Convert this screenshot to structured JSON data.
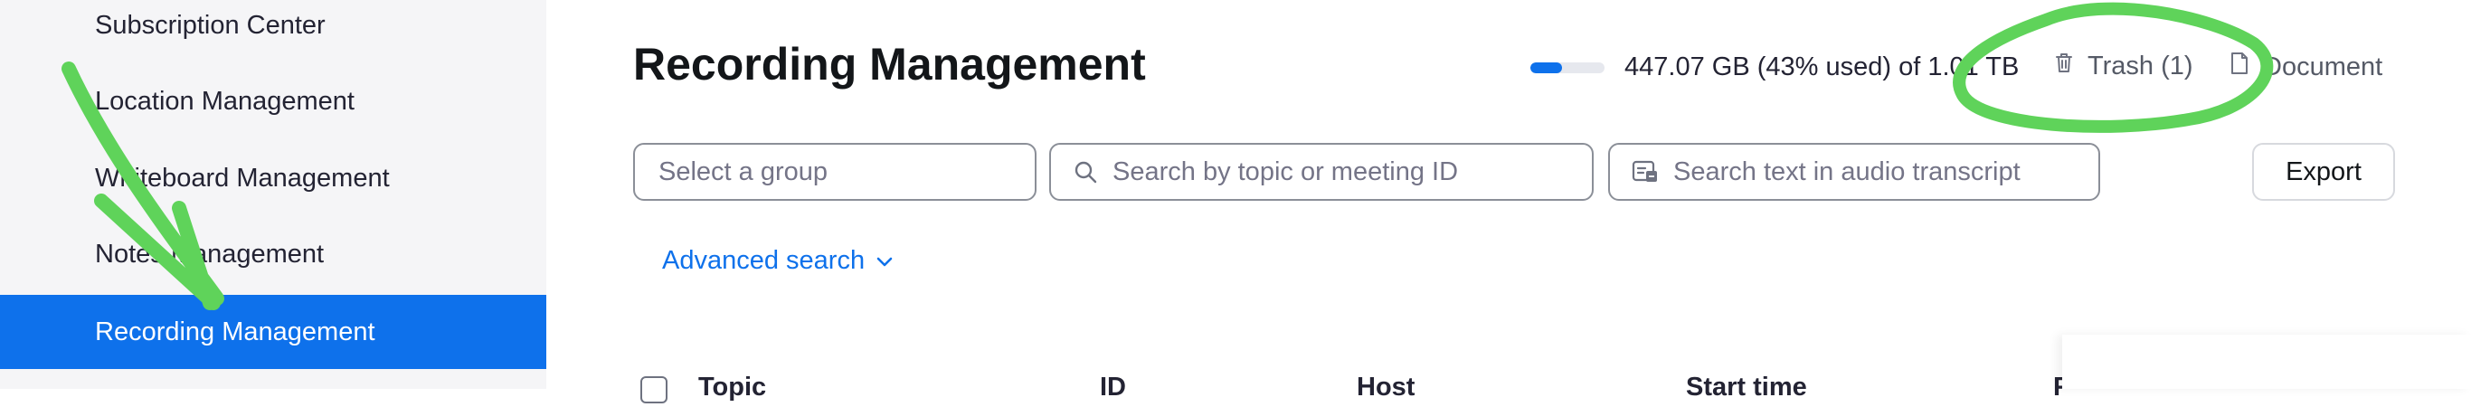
{
  "sidebar": {
    "items": [
      {
        "label": "Subscription Center"
      },
      {
        "label": "Location Management"
      },
      {
        "label": "Whiteboard Management"
      },
      {
        "label": "Notes Management"
      },
      {
        "label": "Recording Management",
        "active": true
      }
    ]
  },
  "header": {
    "title": "Recording Management",
    "storage": {
      "used_fraction": 0.43,
      "text": "447.07 GB (43% used) of 1.01 TB"
    },
    "trash_label": "Trash (1)",
    "document_label": "Document"
  },
  "filters": {
    "group_placeholder": "Select a group",
    "topic_placeholder": "Search by topic or meeting ID",
    "transcript_placeholder": "Search text in audio transcript",
    "export_label": "Export",
    "advanced_search_label": "Advanced search"
  },
  "table": {
    "columns": [
      "Topic",
      "ID",
      "Host",
      "Start time",
      "F"
    ]
  },
  "colors": {
    "accent": "#0e71eb",
    "annotation": "#5fd35a"
  },
  "icons": [
    "trash-icon",
    "document-icon",
    "search-icon",
    "transcript-icon",
    "chevron-down-icon"
  ]
}
